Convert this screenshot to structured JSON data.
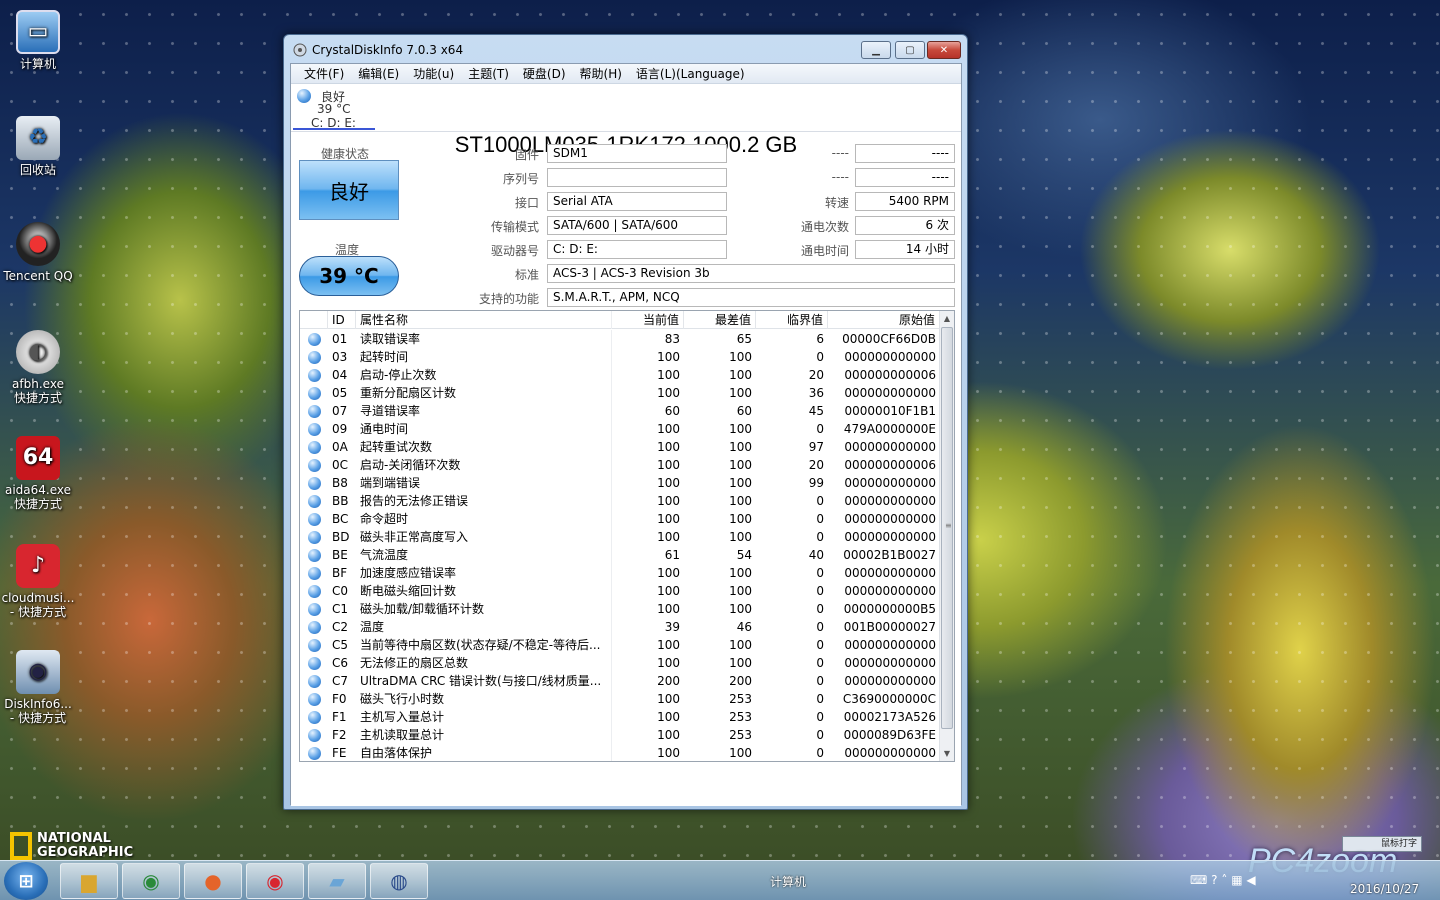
{
  "desktop": {
    "icons": [
      {
        "label": "计算机",
        "sub": ""
      },
      {
        "label": "回收站",
        "sub": ""
      },
      {
        "label": "Tencent QQ",
        "sub": ""
      },
      {
        "label": "afbh.exe",
        "sub": "快捷方式"
      },
      {
        "label": "aida64.exe",
        "sub": "快捷方式"
      },
      {
        "label": "cloudmusi...",
        "sub": "- 快捷方式"
      },
      {
        "label": "DiskInfo6...",
        "sub": "- 快捷方式"
      }
    ],
    "brand": [
      "NATIONAL",
      "GEOGRAPHIC"
    ],
    "watermark": "PC4zoom"
  },
  "window": {
    "title": "CrystalDiskInfo 7.0.3 x64",
    "menu": [
      "文件(F)",
      "编辑(E)",
      "功能(u)",
      "主题(T)",
      "硬盘(D)",
      "帮助(H)",
      "语言(L)(Language)"
    ],
    "disk_tab": {
      "status": "良好",
      "temp": "39 °C",
      "drives": "C: D: E:"
    },
    "disk_title": "ST1000LM035-1RK172 1000.2 GB",
    "health": {
      "label": "健康状态",
      "value": "良好"
    },
    "temperature": {
      "label": "温度",
      "value": "39 °C"
    },
    "fields": {
      "firmware": {
        "label": "固件",
        "value": "SDM1"
      },
      "serial": {
        "label": "序列号",
        "value": ""
      },
      "interface": {
        "label": "接口",
        "value": "Serial ATA"
      },
      "transfer": {
        "label": "传输模式",
        "value": "SATA/600 | SATA/600"
      },
      "drive_letter": {
        "label": "驱动器号",
        "value": "C: D: E:"
      },
      "standard": {
        "label": "标准",
        "value": "ACS-3 | ACS-3 Revision 3b"
      },
      "features": {
        "label": "支持的功能",
        "value": "S.M.A.R.T., APM, NCQ"
      },
      "r1": {
        "label": "----",
        "value": "----"
      },
      "r2": {
        "label": "----",
        "value": "----"
      },
      "rotation": {
        "label": "转速",
        "value": "5400 RPM"
      },
      "power_count": {
        "label": "通电次数",
        "value": "6 次"
      },
      "power_hours": {
        "label": "通电时间",
        "value": "14 小时"
      }
    },
    "table": {
      "headers": [
        "ID",
        "属性名称",
        "当前值",
        "最差值",
        "临界值",
        "原始值"
      ],
      "rows": [
        [
          "01",
          "读取错误率",
          "83",
          "65",
          "6",
          "00000CF66D0B"
        ],
        [
          "03",
          "起转时间",
          "100",
          "100",
          "0",
          "000000000000"
        ],
        [
          "04",
          "启动-停止次数",
          "100",
          "100",
          "20",
          "000000000006"
        ],
        [
          "05",
          "重新分配扇区计数",
          "100",
          "100",
          "36",
          "000000000000"
        ],
        [
          "07",
          "寻道错误率",
          "60",
          "60",
          "45",
          "00000010F1B1"
        ],
        [
          "09",
          "通电时间",
          "100",
          "100",
          "0",
          "479A0000000E"
        ],
        [
          "0A",
          "起转重试次数",
          "100",
          "100",
          "97",
          "000000000000"
        ],
        [
          "0C",
          "启动-关闭循环次数",
          "100",
          "100",
          "20",
          "000000000006"
        ],
        [
          "B8",
          "端到端错误",
          "100",
          "100",
          "99",
          "000000000000"
        ],
        [
          "BB",
          "报告的无法修正错误",
          "100",
          "100",
          "0",
          "000000000000"
        ],
        [
          "BC",
          "命令超时",
          "100",
          "100",
          "0",
          "000000000000"
        ],
        [
          "BD",
          "磁头非正常高度写入",
          "100",
          "100",
          "0",
          "000000000000"
        ],
        [
          "BE",
          "气流温度",
          "61",
          "54",
          "40",
          "00002B1B0027"
        ],
        [
          "BF",
          "加速度感应错误率",
          "100",
          "100",
          "0",
          "000000000000"
        ],
        [
          "C0",
          "断电磁头缩回计数",
          "100",
          "100",
          "0",
          "000000000000"
        ],
        [
          "C1",
          "磁头加载/卸载循环计数",
          "100",
          "100",
          "0",
          "0000000000B5"
        ],
        [
          "C2",
          "温度",
          "39",
          "46",
          "0",
          "001B00000027"
        ],
        [
          "C5",
          "当前等待中扇区数(状态存疑/不稳定-等待后...",
          "100",
          "100",
          "0",
          "000000000000"
        ],
        [
          "C6",
          "无法修正的扇区总数",
          "100",
          "100",
          "0",
          "000000000000"
        ],
        [
          "C7",
          "UltraDMA CRC 错误计数(与接口/线材质量...",
          "200",
          "200",
          "0",
          "000000000000"
        ],
        [
          "F0",
          "磁头飞行小时数",
          "100",
          "253",
          "0",
          "C3690000000C"
        ],
        [
          "F1",
          "主机写入量总计",
          "100",
          "253",
          "0",
          "00002173A526"
        ],
        [
          "F2",
          "主机读取量总计",
          "100",
          "253",
          "0",
          "0000089D63FE"
        ],
        [
          "FE",
          "自由落体保护",
          "100",
          "100",
          "0",
          "000000000000"
        ]
      ]
    }
  },
  "taskbar": {
    "label": "计算机",
    "clock_date": "2016/10/27",
    "tray_box": "鼠标打字"
  }
}
